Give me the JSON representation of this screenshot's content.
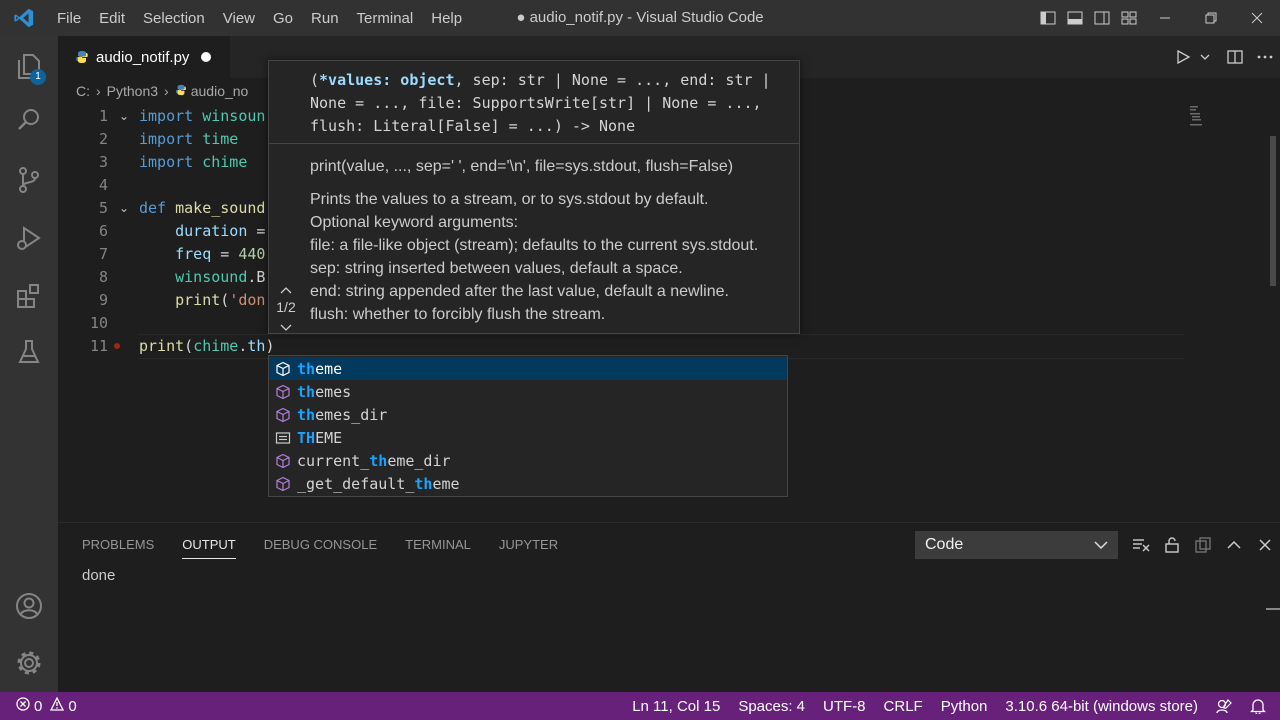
{
  "window": {
    "title": "● audio_notif.py - Visual Studio Code",
    "menus": [
      "File",
      "Edit",
      "Selection",
      "View",
      "Go",
      "Run",
      "Terminal",
      "Help"
    ]
  },
  "activity_bar": {
    "explorer_badge": "1",
    "items": [
      "explorer-icon",
      "search-icon",
      "source-control-icon",
      "run-debug-icon",
      "extensions-icon",
      "testing-icon",
      "accounts-icon",
      "manage-gear-icon"
    ]
  },
  "tab": {
    "label": "audio_notif.py",
    "dirty": true
  },
  "breadcrumb": {
    "root": "C:",
    "folder": "Python3",
    "file": "audio_no"
  },
  "editor": {
    "lines": [
      {
        "n": "1",
        "fold": "⌄",
        "tokens": [
          {
            "c": "kw",
            "t": "import "
          },
          {
            "c": "mod",
            "t": "winsoun"
          }
        ]
      },
      {
        "n": "2",
        "fold": "",
        "tokens": [
          {
            "c": "kw",
            "t": "import "
          },
          {
            "c": "mod",
            "t": "time"
          }
        ]
      },
      {
        "n": "3",
        "fold": "",
        "tokens": [
          {
            "c": "kw",
            "t": "import "
          },
          {
            "c": "mod",
            "t": "chime"
          }
        ]
      },
      {
        "n": "4",
        "fold": "",
        "tokens": []
      },
      {
        "n": "5",
        "fold": "⌄",
        "tokens": [
          {
            "c": "kw",
            "t": "def "
          },
          {
            "c": "fn",
            "t": "make_sound"
          }
        ]
      },
      {
        "n": "6",
        "fold": "",
        "tokens": [
          {
            "c": "plain",
            "t": "    "
          },
          {
            "c": "var",
            "t": "duration"
          },
          {
            "c": "plain",
            "t": " ="
          }
        ]
      },
      {
        "n": "7",
        "fold": "",
        "tokens": [
          {
            "c": "plain",
            "t": "    "
          },
          {
            "c": "var",
            "t": "freq"
          },
          {
            "c": "plain",
            "t": " = "
          },
          {
            "c": "num",
            "t": "440"
          }
        ]
      },
      {
        "n": "8",
        "fold": "",
        "tokens": [
          {
            "c": "plain",
            "t": "    "
          },
          {
            "c": "mod",
            "t": "winsound"
          },
          {
            "c": "plain",
            "t": ".B"
          }
        ]
      },
      {
        "n": "9",
        "fold": "",
        "tokens": [
          {
            "c": "plain",
            "t": "    "
          },
          {
            "c": "fn",
            "t": "print"
          },
          {
            "c": "plain",
            "t": "("
          },
          {
            "c": "str",
            "t": "'don"
          }
        ]
      },
      {
        "n": "10",
        "fold": "",
        "tokens": []
      },
      {
        "n": "11",
        "fold": "",
        "tokens": [
          {
            "c": "fn",
            "t": "print"
          },
          {
            "c": "plain",
            "t": "("
          },
          {
            "c": "mod",
            "t": "chime"
          },
          {
            "c": "plain",
            "t": "."
          },
          {
            "c": "var",
            "t": "th"
          },
          {
            "c": "plain",
            "t": ")"
          }
        ]
      }
    ]
  },
  "hover": {
    "signature": {
      "parts": [
        {
          "c": "plain",
          "t": "("
        },
        {
          "c": "param",
          "t": "*values: object"
        },
        {
          "c": "plain",
          "t": ", sep: str | None = ..., end: str | None = ..., file: SupportsWrite[str] | None = ..., flush: Literal[False] = ...) -> None"
        }
      ]
    },
    "doc_lines": [
      "print(value, ..., sep=' ', end='\\n', file=sys.stdout, flush=False)",
      "Prints the values to a stream, or to sys.stdout by default.",
      "Optional keyword arguments:",
      "file: a file-like object (stream); defaults to the current sys.stdout.",
      "sep: string inserted between values, default a space.",
      "end: string appended after the last value, default a newline.",
      "flush: whether to forcibly flush the stream."
    ],
    "pager": "1/2"
  },
  "suggestions": [
    {
      "pre": "",
      "hl": "th",
      "post": "eme",
      "icon": "cube-icon",
      "selected": true
    },
    {
      "pre": "",
      "hl": "th",
      "post": "emes",
      "icon": "cube-icon",
      "selected": false
    },
    {
      "pre": "",
      "hl": "th",
      "post": "emes_dir",
      "icon": "cube-icon",
      "selected": false
    },
    {
      "pre": "",
      "hl": "TH",
      "post": "EME",
      "icon": "constant-icon",
      "selected": false
    },
    {
      "pre": "current_",
      "hl": "th",
      "post": "eme_dir",
      "icon": "cube-icon",
      "selected": false
    },
    {
      "pre": "_get_default_",
      "hl": "th",
      "post": "eme",
      "icon": "cube-icon",
      "selected": false
    }
  ],
  "panel": {
    "tabs": [
      {
        "label": "PROBLEMS",
        "active": false
      },
      {
        "label": "OUTPUT",
        "active": true
      },
      {
        "label": "DEBUG CONSOLE",
        "active": false
      },
      {
        "label": "TERMINAL",
        "active": false
      },
      {
        "label": "JUPYTER",
        "active": false
      }
    ],
    "output_channel": "Code",
    "output_text": "done"
  },
  "status": {
    "errors": "0",
    "warnings": "0",
    "position": "Ln 11, Col 15",
    "spaces": "Spaces: 4",
    "encoding": "UTF-8",
    "eol": "CRLF",
    "language": "Python",
    "interpreter": "3.10.6 64-bit (windows store)"
  },
  "colors": {
    "statusbar": "#68217a",
    "accent": "#18a3ff",
    "selection": "#04395e"
  }
}
